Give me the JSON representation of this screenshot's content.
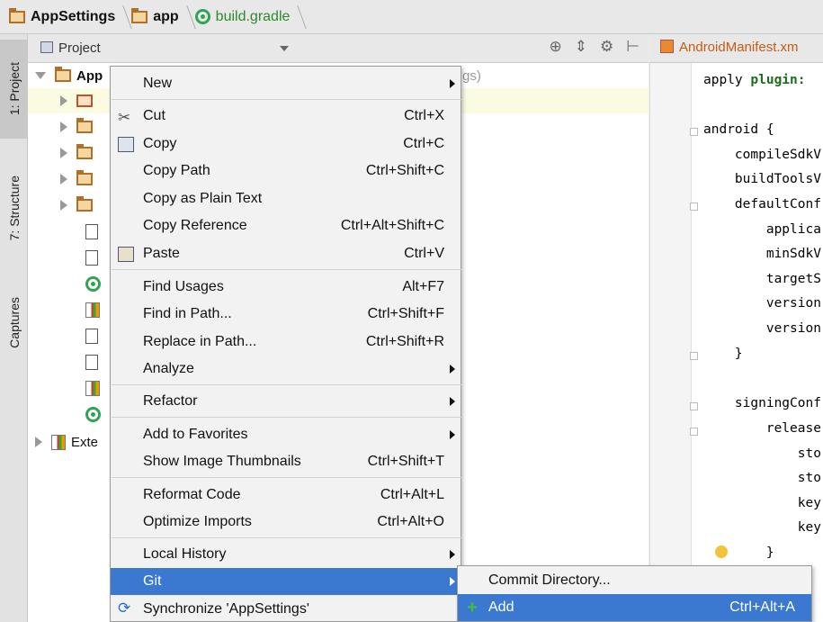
{
  "breadcrumb": {
    "items": [
      {
        "label": "AppSettings"
      },
      {
        "label": "app"
      },
      {
        "label": "build.gradle"
      }
    ]
  },
  "toolstrip": {
    "tab_project": "1: Project",
    "tab_structure": "7: Structure",
    "tab_captures": "Captures"
  },
  "project_panel": {
    "title": "Project",
    "root_label": "App",
    "root_suffix": "gs)",
    "external_label": "Exte"
  },
  "editor": {
    "tab_label": "AndroidManifest.xm",
    "lines": [
      {
        "text": "apply ",
        "kw": "plugin:"
      },
      {
        "text": "android {"
      },
      {
        "text": "    compileSdkV"
      },
      {
        "text": "    buildToolsV"
      },
      {
        "text": "    defaultConf"
      },
      {
        "text": "        applica"
      },
      {
        "text": "        minSdkV"
      },
      {
        "text": "        targetS"
      },
      {
        "text": "        version"
      },
      {
        "text": "        version"
      },
      {
        "text": "    }"
      },
      {
        "text": "    signingConf"
      },
      {
        "text": "        release"
      },
      {
        "text": "            sto"
      },
      {
        "text": "            sto"
      },
      {
        "text": "            key"
      },
      {
        "text": "            key"
      },
      {
        "text": "        }"
      }
    ]
  },
  "context_menu": {
    "items": [
      {
        "label": "New",
        "shortcut": "",
        "submenu": true
      },
      {
        "label": "Cut",
        "shortcut": "Ctrl+X"
      },
      {
        "label": "Copy",
        "shortcut": "Ctrl+C"
      },
      {
        "label": "Copy Path",
        "shortcut": "Ctrl+Shift+C"
      },
      {
        "label": "Copy as Plain Text",
        "shortcut": ""
      },
      {
        "label": "Copy Reference",
        "shortcut": "Ctrl+Alt+Shift+C"
      },
      {
        "label": "Paste",
        "shortcut": "Ctrl+V"
      },
      {
        "label": "Find Usages",
        "shortcut": "Alt+F7"
      },
      {
        "label": "Find in Path...",
        "shortcut": "Ctrl+Shift+F"
      },
      {
        "label": "Replace in Path...",
        "shortcut": "Ctrl+Shift+R"
      },
      {
        "label": "Analyze",
        "shortcut": "",
        "submenu": true
      },
      {
        "label": "Refactor",
        "shortcut": "",
        "submenu": true
      },
      {
        "label": "Add to Favorites",
        "shortcut": "",
        "submenu": true
      },
      {
        "label": "Show Image Thumbnails",
        "shortcut": "Ctrl+Shift+T"
      },
      {
        "label": "Reformat Code",
        "shortcut": "Ctrl+Alt+L"
      },
      {
        "label": "Optimize Imports",
        "shortcut": "Ctrl+Alt+O"
      },
      {
        "label": "Local History",
        "shortcut": "",
        "submenu": true
      },
      {
        "label": "Git",
        "shortcut": "",
        "submenu": true,
        "selected": true
      },
      {
        "label": "Synchronize 'AppSettings'",
        "shortcut": ""
      }
    ]
  },
  "git_submenu": {
    "items": [
      {
        "label": "Commit Directory...",
        "shortcut": ""
      },
      {
        "label": "Add",
        "shortcut": "Ctrl+Alt+A",
        "selected": true
      }
    ]
  },
  "colors": {
    "selection": "#3b78d0",
    "gradle_green": "#31a354",
    "tab_orange": "#c75b12"
  }
}
